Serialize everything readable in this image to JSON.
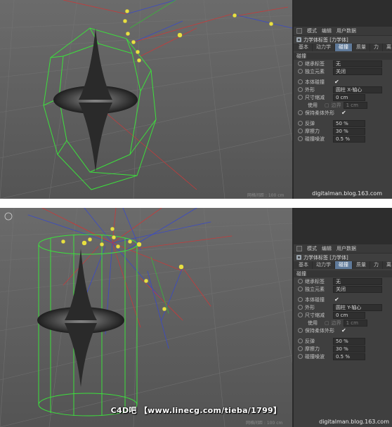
{
  "panel": {
    "menu": [
      "模式",
      "编辑",
      "用户数据"
    ],
    "title": "力学体标签 [力学体]",
    "tabs": [
      "基本",
      "动力学",
      "碰撞",
      "质量",
      "力",
      "离"
    ],
    "active_tab": "碰撞",
    "section": "碰撞",
    "rows": {
      "inherit_label": "继承标签",
      "inherit_value": "无",
      "independent_label": "独立元素",
      "independent_value": "关闭",
      "self_collision_label": "本体碰撞",
      "self_collision_checked": true,
      "shape_label": "外形",
      "size_reduce_label": "尺寸缩减",
      "size_reduce_value": "0 cm",
      "use_label": "使用",
      "margin_label": "边界",
      "margin_value": "1 cm",
      "keep_soft_label": "保持柔体外形",
      "keep_soft_checked": true,
      "bounce_label": "反弹",
      "bounce_value": "50 %",
      "friction_label": "摩擦力",
      "friction_value": "30 %",
      "noise_label": "碰撞噪波",
      "noise_value": "0.5 %"
    }
  },
  "screens": [
    {
      "shape_value": "圆柱 X-轴心",
      "viewport_scale": "网格间距 : 100 cm",
      "watermark": "digitalman.blog.163.com"
    },
    {
      "shape_value": "圆柱 Y-轴心",
      "viewport_scale": "网格间距 : 100 cm",
      "watermark": "digitalman.blog.163.com"
    }
  ],
  "banner": "C4D吧 【www.linecg.com/tieba/1799】",
  "colors": {
    "viewport": "#5b5b5b",
    "panel": "#3f3f3f",
    "active_tab": "#5f7a9a",
    "cage": "#3ce03c",
    "key": "#e8e040"
  }
}
